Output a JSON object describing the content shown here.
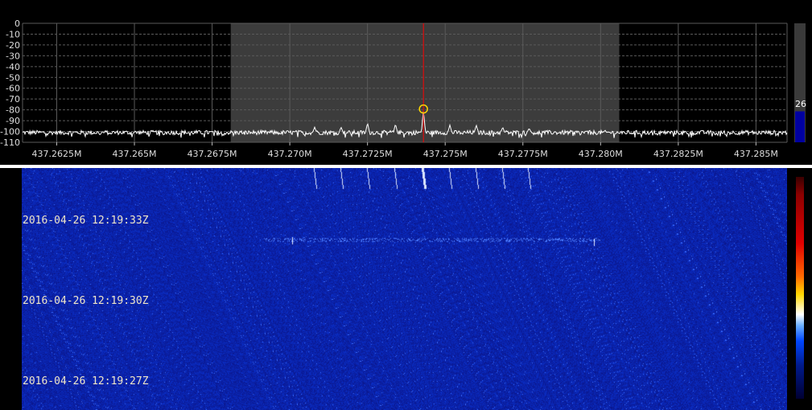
{
  "spectrum": {
    "db_labels": [
      "0",
      "-10",
      "-20",
      "-30",
      "-40",
      "-50",
      "-60",
      "-70",
      "-80",
      "-90",
      "-100",
      "-110"
    ],
    "db_range": [
      -110,
      0
    ],
    "freq_labels": [
      "437.2625M",
      "437.265M",
      "437.2675M",
      "437.270M",
      "437.2725M",
      "437.275M",
      "437.2775M",
      "437.280M",
      "437.2825M",
      "437.285M"
    ],
    "freq_range_hz": [
      437261400,
      437286000
    ],
    "passband_hz": [
      437268100,
      437280600
    ],
    "tuned_freq_hz": 437274300,
    "peak_marker_db": -77,
    "noise_floor_db": -101,
    "peaks": [
      {
        "freq_hz": 437270800,
        "db": -96
      },
      {
        "freq_hz": 437271650,
        "db": -96
      },
      {
        "freq_hz": 437272500,
        "db": -92
      },
      {
        "freq_hz": 437273400,
        "db": -93
      },
      {
        "freq_hz": 437274300,
        "db": -80
      },
      {
        "freq_hz": 437275150,
        "db": -94
      },
      {
        "freq_hz": 437276000,
        "db": -94
      },
      {
        "freq_hz": 437276850,
        "db": -96
      },
      {
        "freq_hz": 437277700,
        "db": -97
      }
    ],
    "level_value": "26",
    "level_fraction": 0.26
  },
  "waterfall": {
    "timestamps": [
      "2016-04-26 12:19:33Z",
      "2016-04-26 12:19:30Z",
      "2016-04-26 12:19:27Z"
    ]
  },
  "colors": {
    "background": "#000000",
    "grid": "#5a5a5a",
    "passband": "#3c3c3c",
    "trace": "#ffffff",
    "tuning_line": "#ff0000",
    "peak_marker": "#ffd700",
    "waterfall_base": "#0a1a9a",
    "level_bar": "#0000a0"
  }
}
